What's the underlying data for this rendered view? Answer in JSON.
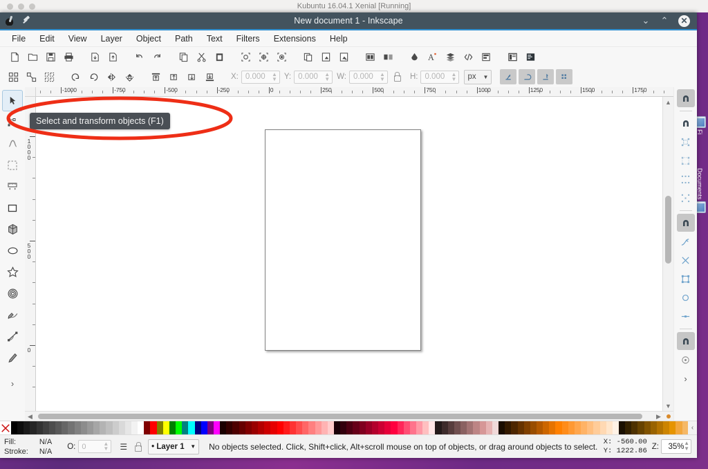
{
  "host": {
    "vm_label": "Kubuntu 16.04.1 Xenial [Running]",
    "desktop_icons": [
      {
        "name": "firefox",
        "label": "Fi"
      },
      {
        "name": "documents",
        "label": "Documents"
      }
    ]
  },
  "window": {
    "title": "New document 1 - Inkscape",
    "controls": {
      "minimize": "⌄",
      "maximize": "⌃",
      "close": "✕"
    }
  },
  "menubar": {
    "items": [
      "File",
      "Edit",
      "View",
      "Layer",
      "Object",
      "Path",
      "Text",
      "Filters",
      "Extensions",
      "Help"
    ]
  },
  "commandbar": {
    "buttons": [
      {
        "name": "new-document",
        "title": "New"
      },
      {
        "name": "open-document",
        "title": "Open"
      },
      {
        "name": "save-document",
        "title": "Save"
      },
      {
        "name": "print-document",
        "title": "Print"
      },
      {
        "name": "import",
        "title": "Import"
      },
      {
        "name": "export",
        "title": "Export PNG Image"
      },
      {
        "name": "undo",
        "title": "Undo"
      },
      {
        "name": "redo",
        "title": "Redo"
      },
      {
        "name": "copy",
        "title": "Copy"
      },
      {
        "name": "cut",
        "title": "Cut"
      },
      {
        "name": "paste",
        "title": "Paste"
      },
      {
        "name": "zoom-selection",
        "title": "Zoom to selection"
      },
      {
        "name": "zoom-drawing",
        "title": "Zoom to drawing"
      },
      {
        "name": "zoom-page",
        "title": "Zoom to page"
      },
      {
        "name": "duplicate",
        "title": "Duplicate"
      },
      {
        "name": "clone",
        "title": "Clone"
      },
      {
        "name": "unlink-clone",
        "title": "Unlink clone"
      },
      {
        "name": "group",
        "title": "Group"
      },
      {
        "name": "ungroup",
        "title": "Ungroup"
      },
      {
        "name": "fill-and-stroke",
        "title": "Fill and Stroke"
      },
      {
        "name": "text-and-font",
        "title": "Text and Font"
      },
      {
        "name": "layers",
        "title": "Layers"
      },
      {
        "name": "xml-editor",
        "title": "XML Editor"
      },
      {
        "name": "align-and-distribute",
        "title": "Align and Distribute"
      },
      {
        "name": "document-properties",
        "title": "Document Properties"
      },
      {
        "name": "preferences",
        "title": "Preferences"
      }
    ]
  },
  "toolcontrols": {
    "buttons": [
      {
        "name": "select-all",
        "title": "Select All"
      },
      {
        "name": "select-all-in-all-layers",
        "title": "Select All in All Layers"
      },
      {
        "name": "deselect",
        "title": "Deselect"
      },
      {
        "name": "rotate-ccw",
        "title": "Rotate 90° CCW"
      },
      {
        "name": "rotate-cw",
        "title": "Rotate 90° CW"
      },
      {
        "name": "flip-horizontal",
        "title": "Flip Horizontal"
      },
      {
        "name": "flip-vertical",
        "title": "Flip Vertical"
      },
      {
        "name": "raise-to-top",
        "title": "Raise to Top"
      },
      {
        "name": "raise",
        "title": "Raise"
      },
      {
        "name": "lower",
        "title": "Lower"
      },
      {
        "name": "lower-to-bottom",
        "title": "Lower to Bottom"
      }
    ],
    "fields": [
      {
        "name": "x-field",
        "label": "X:",
        "value": "0.000"
      },
      {
        "name": "y-field",
        "label": "Y:",
        "value": "0.000"
      },
      {
        "name": "w-field",
        "label": "W:",
        "value": "0.000"
      },
      {
        "name": "h-field",
        "label": "H:",
        "value": "0.000"
      }
    ],
    "lock_ratio": "lock-icon",
    "unit": "px",
    "affect_buttons": [
      {
        "name": "affect-stroke-width"
      },
      {
        "name": "affect-rounded-corners"
      },
      {
        "name": "affect-gradients"
      },
      {
        "name": "affect-patterns"
      }
    ]
  },
  "toolbox": {
    "tools": [
      {
        "name": "selector-tool",
        "label": "Select and transform objects",
        "active": true
      },
      {
        "name": "node-tool",
        "label": "Edit paths by nodes",
        "active": false
      },
      {
        "name": "tweak-tool",
        "label": "Tweak objects",
        "active": false
      },
      {
        "name": "zoom-tool",
        "label": "Zoom in or out",
        "active": false
      },
      {
        "name": "measure-tool",
        "label": "Measure objects",
        "active": false
      },
      {
        "name": "rectangle-tool",
        "label": "Create rectangles and squares",
        "active": false
      },
      {
        "name": "box3d-tool",
        "label": "Create 3D boxes",
        "active": false
      },
      {
        "name": "ellipse-tool",
        "label": "Create circles, ellipses and arcs",
        "active": false
      },
      {
        "name": "star-tool",
        "label": "Create stars and polygons",
        "active": false
      },
      {
        "name": "spiral-tool",
        "label": "Create spirals",
        "active": false
      },
      {
        "name": "pencil-tool",
        "label": "Draw freehand lines",
        "active": false
      },
      {
        "name": "bezier-tool",
        "label": "Draw Bezier curves and straight lines",
        "active": false
      },
      {
        "name": "calligraphy-tool",
        "label": "Draw calligraphic or brush strokes",
        "active": false
      }
    ],
    "overflow": "chevron-right-icon"
  },
  "tooltip": {
    "text": "Select and transform objects (F1)"
  },
  "rulers": {
    "horizontal_labels": [
      "-1000",
      "-750",
      "-500",
      "-250",
      "0",
      "250",
      "500",
      "750",
      "1000",
      "1250",
      "1500",
      "1750"
    ],
    "vertical_labels": [
      "1000",
      "500",
      "0"
    ],
    "unit": "px"
  },
  "snapbar": {
    "buttons": [
      {
        "name": "enable-snapping",
        "on": true
      },
      {
        "name": "snap-bounding-boxes",
        "on": false
      },
      {
        "name": "snap-bbox-edges",
        "on": false
      },
      {
        "name": "snap-bbox-corners",
        "on": false
      },
      {
        "name": "snap-bbox-edge-midpoints",
        "on": false
      },
      {
        "name": "snap-bbox-centers",
        "on": false
      },
      {
        "name": "snap-nodes-paths-handles",
        "on": true
      },
      {
        "name": "snap-paths",
        "on": false
      },
      {
        "name": "snap-path-intersections",
        "on": false
      },
      {
        "name": "snap-to-nodes",
        "on": false
      },
      {
        "name": "snap-smooth-nodes",
        "on": false
      },
      {
        "name": "snap-line-midpoints",
        "on": false
      },
      {
        "name": "snap-others",
        "on": true
      },
      {
        "name": "snap-object-centers",
        "on": false
      }
    ],
    "overflow": "chevron-right-icon"
  },
  "palette": {
    "none_swatch": "none-color-x-icon",
    "arrow": "chevron-left-icon",
    "colors": [
      "#000000",
      "#0d0d0d",
      "#1a1a1a",
      "#262626",
      "#333333",
      "#404040",
      "#4d4d4d",
      "#595959",
      "#666666",
      "#737373",
      "#808080",
      "#8c8c8c",
      "#999999",
      "#a6a6a6",
      "#b3b3b3",
      "#bfbfbf",
      "#cccccc",
      "#d9d9d9",
      "#e6e6e6",
      "#f2f2f2",
      "#ffffff",
      "#800000",
      "#ff0000",
      "#808000",
      "#ffff00",
      "#008000",
      "#00ff00",
      "#008080",
      "#00ffff",
      "#000080",
      "#0000ff",
      "#800080",
      "#ff00ff",
      "#1a0000",
      "#330000",
      "#4d0000",
      "#660000",
      "#800000",
      "#990000",
      "#b30000",
      "#cc0000",
      "#e60000",
      "#ff0000",
      "#ff1a1a",
      "#ff3333",
      "#ff4d4d",
      "#ff6666",
      "#ff8080",
      "#ff9999",
      "#ffb3b3",
      "#ffcccc",
      "#1a0008",
      "#33000d",
      "#4d0013",
      "#660019",
      "#80001f",
      "#990026",
      "#b3002c",
      "#cc0033",
      "#e60039",
      "#ff003f",
      "#ff2659",
      "#ff4d73",
      "#ff738c",
      "#ff99a6",
      "#ffbfc0",
      "#ffe6e6",
      "#241a1a",
      "#3d2b2b",
      "#573d3d",
      "#704f4f",
      "#8a6161",
      "#a37373",
      "#bd8585",
      "#d69797",
      "#e6b3b3",
      "#f0d9d9",
      "#1a0d00",
      "#331a00",
      "#4d2600",
      "#663300",
      "#804000",
      "#994d00",
      "#b35900",
      "#cc6600",
      "#e67300",
      "#ff8000",
      "#ff8c1a",
      "#ff9933",
      "#ffa64d",
      "#ffb366",
      "#ffbf80",
      "#ffcc99",
      "#ffd9b3",
      "#ffe6cc",
      "#fff2e6",
      "#1a1000",
      "#332100",
      "#4d3100",
      "#664200",
      "#805200",
      "#996300",
      "#b37300",
      "#cc8400",
      "#e69400",
      "#f2a73d",
      "#f5b866"
    ]
  },
  "statusbar": {
    "fill_label": "Fill:",
    "fill_value": "N/A",
    "stroke_label": "Stroke:",
    "stroke_value": "N/A",
    "opacity_label": "O:",
    "opacity_value": "0",
    "layer_visibility_icon": "eye-icon",
    "layer_lock_icon": "unlock-icon",
    "layer_name": "• Layer 1",
    "message": "No objects selected. Click, Shift+click, Alt+scroll mouse on top of objects, or drag around objects to select.",
    "x_label": "X:",
    "x_value": "-560.00",
    "y_label": "Y:",
    "y_value": "1222.86",
    "zoom_label": "Z:",
    "zoom_value": "35%"
  },
  "annotation": {
    "name": "red-ellipse-highlight",
    "color": "#ee2e16"
  }
}
